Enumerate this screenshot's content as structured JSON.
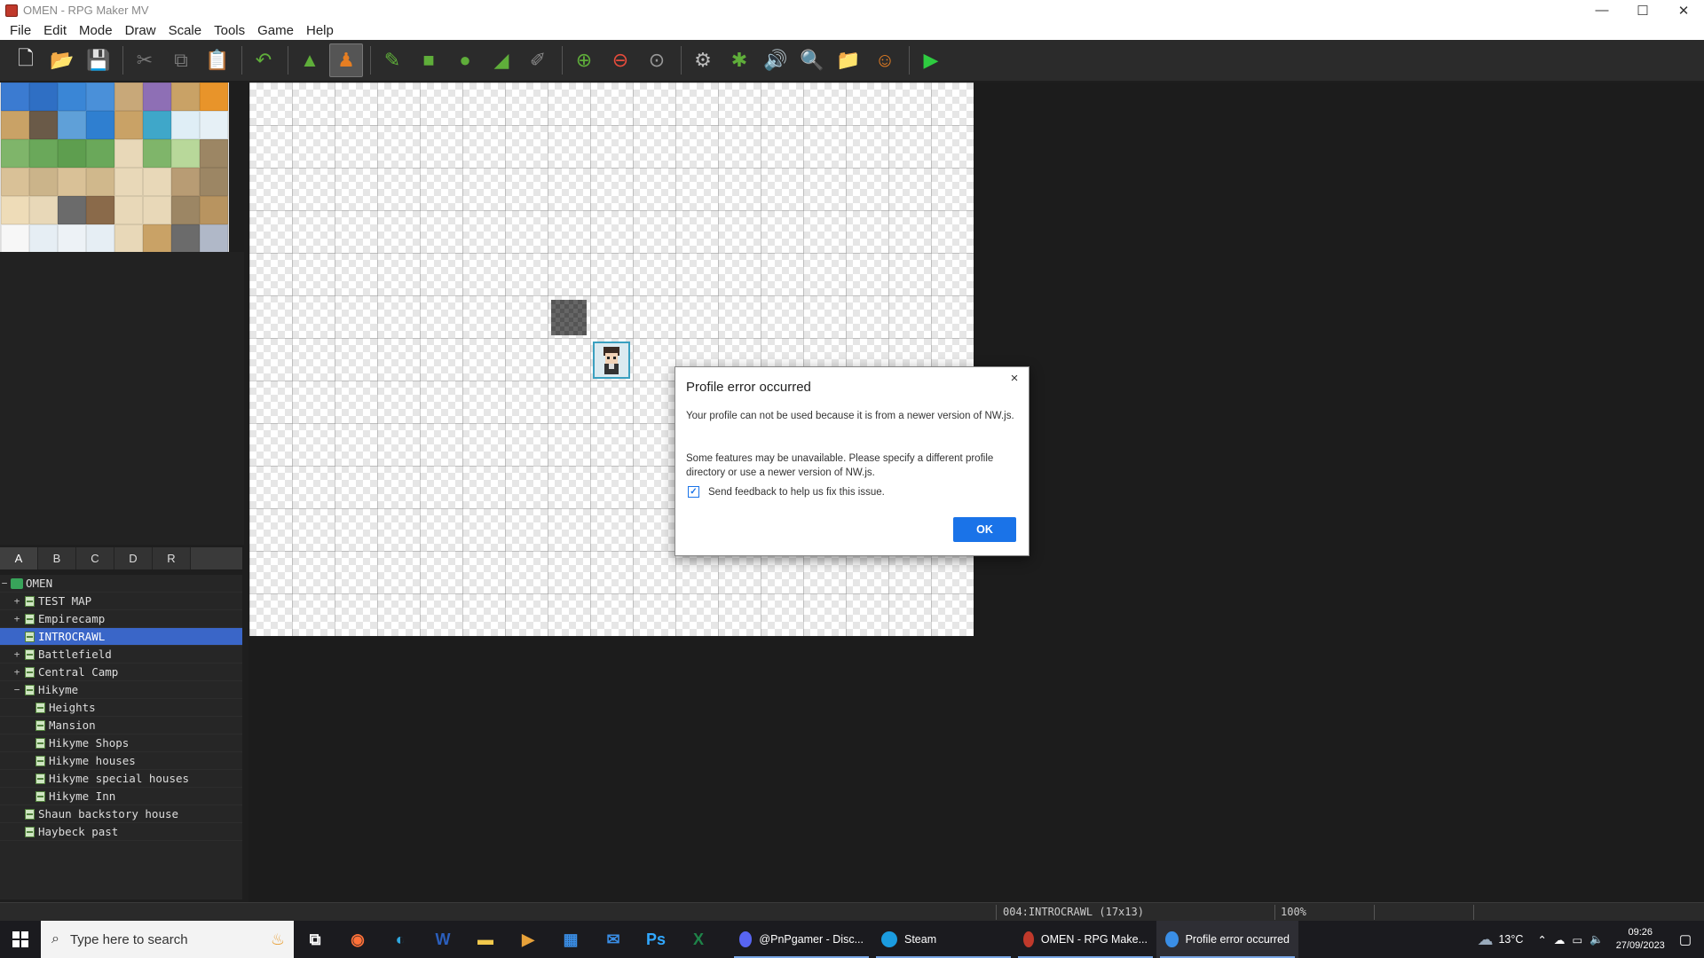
{
  "window": {
    "title": "OMEN - RPG Maker MV",
    "controls": {
      "minimize": "—",
      "maximize": "☐",
      "close": "✕"
    }
  },
  "menubar": {
    "items": [
      "File",
      "Edit",
      "Mode",
      "Draw",
      "Scale",
      "Tools",
      "Game",
      "Help"
    ]
  },
  "toolbar": {
    "buttons": [
      {
        "name": "new-project-icon",
        "glyph": "🗋",
        "color": "#ffffff"
      },
      {
        "name": "open-project-icon",
        "glyph": "📂",
        "color": "#f2c94c"
      },
      {
        "name": "save-project-icon",
        "glyph": "💾",
        "color": "#cccccc"
      },
      {
        "name": "cut-icon",
        "glyph": "✂",
        "color": "#777777"
      },
      {
        "name": "copy-icon",
        "glyph": "⧉",
        "color": "#777777"
      },
      {
        "name": "paste-icon",
        "glyph": "📋",
        "color": "#777777"
      },
      {
        "name": "undo-icon",
        "glyph": "↶",
        "color": "#5fae3a"
      },
      {
        "name": "map-mode-icon",
        "glyph": "▲",
        "color": "#5fae3a"
      },
      {
        "name": "event-mode-icon",
        "glyph": "♟",
        "color": "#e67e22"
      },
      {
        "name": "pencil-icon",
        "glyph": "✎",
        "color": "#5fae3a"
      },
      {
        "name": "rectangle-icon",
        "glyph": "■",
        "color": "#5fae3a"
      },
      {
        "name": "ellipse-icon",
        "glyph": "●",
        "color": "#5fae3a"
      },
      {
        "name": "flood-fill-icon",
        "glyph": "◢",
        "color": "#5fae3a"
      },
      {
        "name": "shadow-pen-icon",
        "glyph": "✐",
        "color": "#888888"
      },
      {
        "name": "zoom-in-icon",
        "glyph": "⊕",
        "color": "#5fae3a"
      },
      {
        "name": "zoom-out-icon",
        "glyph": "⊖",
        "color": "#e74c3c"
      },
      {
        "name": "actual-size-icon",
        "glyph": "⊙",
        "color": "#999999"
      },
      {
        "name": "database-icon",
        "glyph": "⚙",
        "color": "#bbbbbb"
      },
      {
        "name": "plugin-manager-icon",
        "glyph": "✱",
        "color": "#5fae3a"
      },
      {
        "name": "sound-test-icon",
        "glyph": "🔊",
        "color": "#f2c94c"
      },
      {
        "name": "event-searcher-icon",
        "glyph": "🔍",
        "color": "#9bd3e8"
      },
      {
        "name": "resource-manager-icon",
        "glyph": "📁",
        "color": "#f2c94c"
      },
      {
        "name": "character-generator-icon",
        "glyph": "☺",
        "color": "#e67e22"
      },
      {
        "name": "playtest-icon",
        "glyph": "▶",
        "color": "#2ecc40"
      }
    ]
  },
  "palette": {
    "tiles": [
      "#3b7bd1",
      "#2f6fc4",
      "#3a86d6",
      "#4a90d9",
      "#c8a879",
      "#8e6fb5",
      "#c9a266",
      "#e8942a",
      "#c9a266",
      "#6a5a48",
      "#5fa0d8",
      "#2f7fd0",
      "#c9a266",
      "#3fa7c9",
      "#dfeef6",
      "#e6f0f6",
      "#7fb56a",
      "#6aa85a",
      "#5e9e4f",
      "#6aa85a",
      "#e8d8b8",
      "#7fb56a",
      "#b8d89a",
      "#9c8664",
      "#d9c197",
      "#cbb48a",
      "#d9c197",
      "#d0b88c",
      "#e8d8b8",
      "#e8d8b8",
      "#b89c74",
      "#9c8664",
      "#eedcb8",
      "#e8d8b8",
      "#6b6b6b",
      "#8a6a4a",
      "#e8d8b8",
      "#e8d8b8",
      "#9c8664",
      "#b89460",
      "#f7f7f7",
      "#e6eef4",
      "#edf2f6",
      "#e6eef4",
      "#e8d8b8",
      "#c9a266",
      "#6b6b6b",
      "#b0b8c8"
    ]
  },
  "tabs": [
    "A",
    "B",
    "C",
    "D",
    "R"
  ],
  "tree": {
    "root": "OMEN",
    "items": [
      {
        "label": "TEST MAP",
        "level": 1,
        "expander": "+"
      },
      {
        "label": "Empirecamp",
        "level": 1,
        "expander": "+"
      },
      {
        "label": "INTROCRAWL",
        "level": 1,
        "expander": "",
        "selected": true
      },
      {
        "label": "Battlefield",
        "level": 1,
        "expander": "+"
      },
      {
        "label": "Central Camp",
        "level": 1,
        "expander": "+"
      },
      {
        "label": "Hikyme",
        "level": 1,
        "expander": "−"
      },
      {
        "label": "Heights",
        "level": 2,
        "expander": ""
      },
      {
        "label": "Mansion",
        "level": 2,
        "expander": ""
      },
      {
        "label": "Hikyme Shops",
        "level": 2,
        "expander": ""
      },
      {
        "label": "Hikyme houses",
        "level": 2,
        "expander": ""
      },
      {
        "label": "Hikyme special houses",
        "level": 2,
        "expander": ""
      },
      {
        "label": "Hikyme Inn",
        "level": 2,
        "expander": ""
      },
      {
        "label": "Shaun backstory house",
        "level": 1,
        "expander": ""
      },
      {
        "label": "Haybeck past",
        "level": 1,
        "expander": ""
      }
    ]
  },
  "statusbar": {
    "map_info": "004:INTROCRAWL (17x13)",
    "zoom": "100%"
  },
  "dialog": {
    "title": "Profile error occurred",
    "message1": "Your profile can not be used because it is from a newer version of NW.js.",
    "message2": "Some features may be unavailable. Please specify a different profile directory or use a newer version of NW.js.",
    "checkbox_label": "Send feedback to help us fix this issue.",
    "checkbox_checked": true,
    "ok_label": "OK",
    "close": "×"
  },
  "taskbar": {
    "search_placeholder": "Type here to search",
    "pinned": [
      {
        "name": "task-view-icon",
        "glyph": "⧉",
        "color": "#ffffff"
      },
      {
        "name": "firefox-icon",
        "glyph": "◉",
        "color": "#ff7139"
      },
      {
        "name": "edge-icon",
        "glyph": "◐",
        "color": "#2fa8e0"
      },
      {
        "name": "word-icon",
        "glyph": "W",
        "color": "#2b5fbd"
      },
      {
        "name": "file-explorer-icon",
        "glyph": "▬",
        "color": "#f2c94c"
      },
      {
        "name": "media-player-icon",
        "glyph": "▶",
        "color": "#e8a23a"
      },
      {
        "name": "calculator-icon",
        "glyph": "▦",
        "color": "#3a8ee6"
      },
      {
        "name": "mail-icon",
        "glyph": "✉",
        "color": "#3a8ee6"
      },
      {
        "name": "photoshop-icon",
        "glyph": "Ps",
        "color": "#31a8ff"
      },
      {
        "name": "excel-icon",
        "glyph": "X",
        "color": "#1e8449"
      }
    ],
    "tasks": [
      {
        "label": "@PnPgamer - Disc...",
        "name": "discord-task",
        "icon_color": "#5865f2"
      },
      {
        "label": "Steam",
        "name": "steam-task",
        "icon_color": "#1b9ce0"
      },
      {
        "label": "OMEN - RPG Make...",
        "name": "rpgmaker-task",
        "icon_color": "#c0392b"
      },
      {
        "label": "Profile error occurred",
        "name": "profile-error-task",
        "icon_color": "#3a8ee6"
      }
    ],
    "weather": "13°C",
    "time": "09:26",
    "date": "27/09/2023"
  }
}
